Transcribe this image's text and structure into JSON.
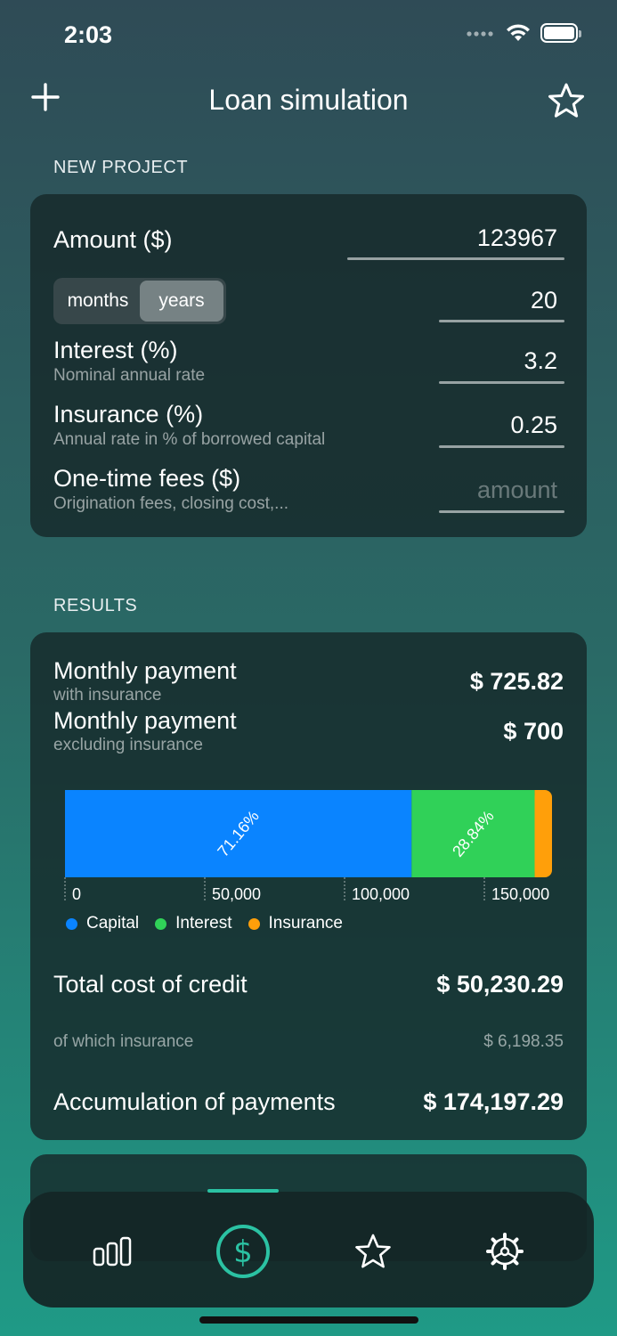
{
  "status_bar": {
    "time": "2:03"
  },
  "nav": {
    "title": "Loan simulation"
  },
  "project": {
    "section_label": "NEW PROJECT",
    "amount_label": "Amount ($)",
    "amount_value": "123967",
    "duration_units": [
      "months",
      "years"
    ],
    "duration_selected": "years",
    "duration_value": "20",
    "interest_label": "Interest (%)",
    "interest_sub": "Nominal annual rate",
    "interest_value": "3.2",
    "insurance_label": "Insurance (%)",
    "insurance_sub": "Annual rate in % of borrowed capital",
    "insurance_value": "0.25",
    "fees_label": "One-time fees ($)",
    "fees_sub": "Origination fees, closing cost,...",
    "fees_placeholder": "amount"
  },
  "results": {
    "section_label": "RESULTS",
    "monthly_with_label": "Monthly payment",
    "monthly_with_sub": "with insurance",
    "monthly_with_value": "$ 725.82",
    "monthly_without_label": "Monthly payment",
    "monthly_without_sub": "excluding insurance",
    "monthly_without_value": "$ 700",
    "total_cost_label": "Total cost of credit",
    "total_cost_value": "$ 50,230.29",
    "insurance_part_label": "of which insurance",
    "insurance_part_value": "$ 6,198.35",
    "accumulation_label": "Accumulation of payments",
    "accumulation_value": "$ 174,197.29"
  },
  "chart_data": {
    "type": "bar",
    "orientation": "horizontal-stacked",
    "series": [
      {
        "name": "Capital",
        "value": 123967,
        "label": "71.16%",
        "color": "#0a84ff"
      },
      {
        "name": "Interest",
        "value": 44032,
        "label": "28.84%",
        "color": "#30d158"
      },
      {
        "name": "Insurance",
        "value": 6198.35,
        "label": "",
        "color": "#ff9f0a"
      }
    ],
    "x_ticks": [
      "0",
      "50,000",
      "100,000",
      "150,000"
    ],
    "x_tick_values": [
      0,
      50000,
      100000,
      150000
    ],
    "xlim": [
      0,
      174197.29
    ]
  },
  "tabs": [
    {
      "icon": "bar-chart-icon"
    },
    {
      "icon": "dollar-circle-icon",
      "active": true
    },
    {
      "icon": "star-icon"
    },
    {
      "icon": "gear-icon"
    }
  ],
  "colors": {
    "accent": "#2bc2a3"
  }
}
